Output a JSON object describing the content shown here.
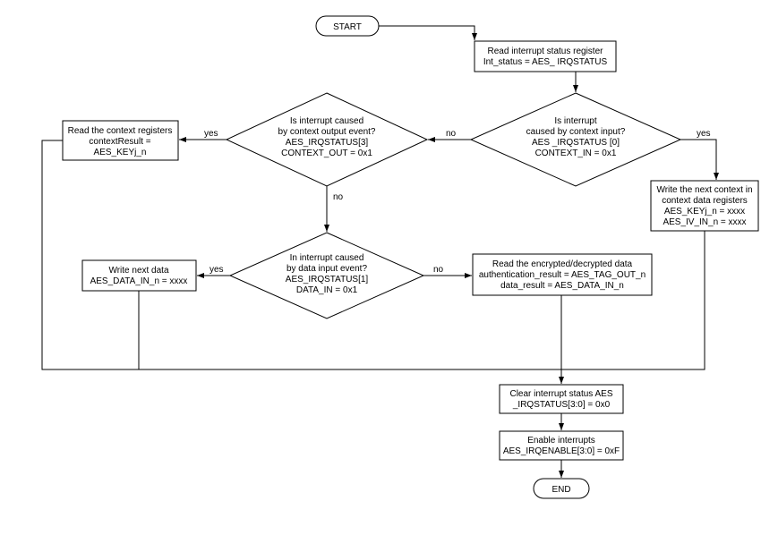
{
  "start": "START",
  "end": "END",
  "read_irq_box": {
    "l1": "Read interrupt status register",
    "l2": "Int_status = AES_ IRQSTATUS"
  },
  "context_in_diamond": {
    "l1": "Is interrupt",
    "l2": "caused by context input?",
    "l3": "AES _IRQSTATUS [0]",
    "l4": "CONTEXT_IN = 0x1"
  },
  "context_out_diamond": {
    "l1": "Is interrupt caused",
    "l2": "by context output event?",
    "l3": "AES_IRQSTATUS[3]",
    "l4": "CONTEXT_OUT = 0x1"
  },
  "data_in_diamond": {
    "l1": "In interrupt caused",
    "l2": "by data input event?",
    "l3": "AES_IRQSTATUS[1]",
    "l4": "DATA_IN = 0x1"
  },
  "read_context_box": {
    "l1": "Read the context registers",
    "l2": "contextResult =",
    "l3": "AES_KEYj_n"
  },
  "write_context_box": {
    "l1": "Write the next context in",
    "l2": "context data registers",
    "l3": "AES_KEYj_n = xxxx",
    "l4": "AES_IV_IN_n = xxxx"
  },
  "write_data_box": {
    "l1": "Write next data",
    "l2": "AES_DATA_IN_n = xxxx"
  },
  "read_data_box": {
    "l1": "Read the encrypted/decrypted data",
    "l2": "authentication_result = AES_TAG_OUT_n",
    "l3": "data_result = AES_DATA_IN_n"
  },
  "clear_irq_box": {
    "l1": "Clear interrupt status AES",
    "l2": "_IRQSTATUS[3:0] = 0x0"
  },
  "enable_irq_box": {
    "l1": "Enable interrupts",
    "l2": "AES_IRQENABLE[3:0]  = 0xF"
  },
  "labels": {
    "yes": "yes",
    "no": "no"
  }
}
